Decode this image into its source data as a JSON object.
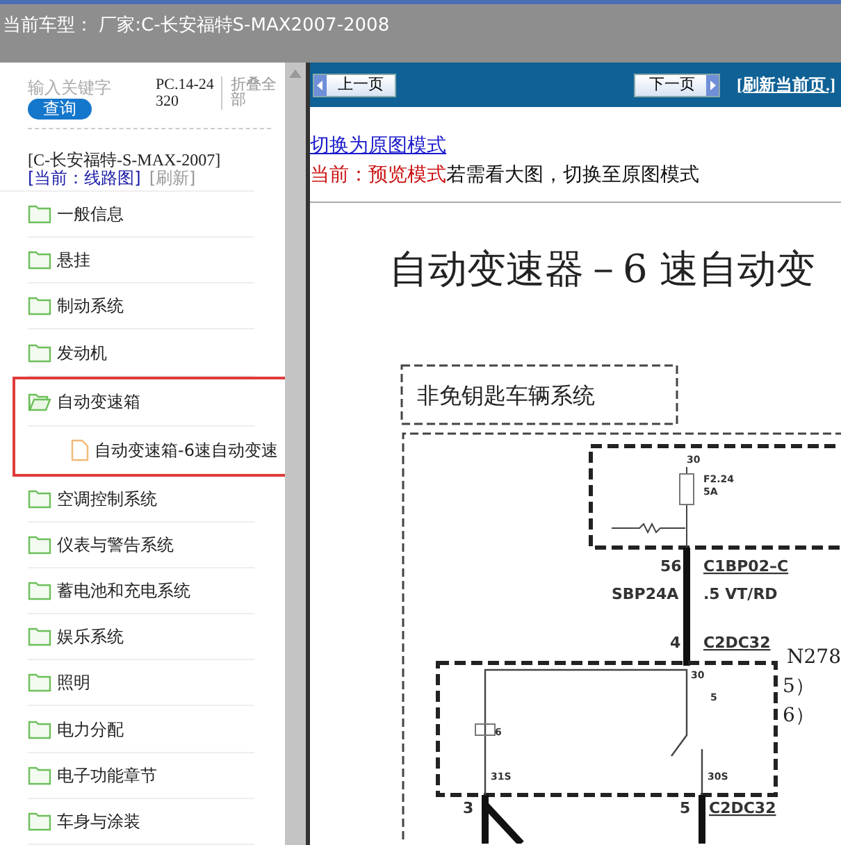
{
  "title_bar": {
    "text": "当前车型：  厂家:C-长安福特S-MAX2007-2008"
  },
  "sidebar": {
    "search": {
      "placeholder": "输入关键字",
      "button": "查询"
    },
    "code": "PC.14-24320",
    "collapse_all": "折叠全部",
    "vehicle": "[C-长安福特-S-MAX-2007]",
    "current": "[当前：线路图]",
    "refresh": "[刷新]",
    "tree": [
      {
        "label": "一般信息",
        "expanded": false
      },
      {
        "label": "悬挂",
        "expanded": false
      },
      {
        "label": "制动系统",
        "expanded": false
      },
      {
        "label": "发动机",
        "expanded": false
      },
      {
        "label": "自动变速箱",
        "expanded": true,
        "highlighted": true,
        "children": [
          {
            "label": "自动变速箱-6速自动变速"
          }
        ]
      },
      {
        "label": "空调控制系统",
        "expanded": false
      },
      {
        "label": "仪表与警告系统",
        "expanded": false
      },
      {
        "label": "蓄电池和充电系统",
        "expanded": false
      },
      {
        "label": "娱乐系统",
        "expanded": false
      },
      {
        "label": "照明",
        "expanded": false
      },
      {
        "label": "电力分配",
        "expanded": false
      },
      {
        "label": "电子功能章节",
        "expanded": false
      },
      {
        "label": "车身与涂装",
        "expanded": false
      }
    ]
  },
  "toolbar": {
    "prev": "上一页",
    "next": "下一页",
    "refresh": "[刷新当前页.]"
  },
  "mode": {
    "switch_link": "切换为原图模式",
    "current_label": "当前：预览模式",
    "hint": "若需看大图，切换至原图模式"
  },
  "diagram": {
    "title": "自动变速器－6 速自动变",
    "system_box": "非免钥匙车辆系统",
    "labels": [
      {
        "text": "30"
      },
      {
        "text": "F2.24"
      },
      {
        "text": "5A"
      },
      {
        "text": "56"
      },
      {
        "text": "C1BP02–C"
      },
      {
        "text": "SBP24A"
      },
      {
        "text": ".5 VT/RD"
      },
      {
        "text": "4"
      },
      {
        "text": "C2DC32"
      },
      {
        "text": "30"
      },
      {
        "text": "5"
      },
      {
        "text": "6"
      },
      {
        "text": "31S"
      },
      {
        "text": "30S"
      },
      {
        "text": "3"
      },
      {
        "text": "5"
      },
      {
        "text": "C2DC32"
      }
    ],
    "notes": [
      "N278",
      "5）",
      "6）"
    ]
  }
}
